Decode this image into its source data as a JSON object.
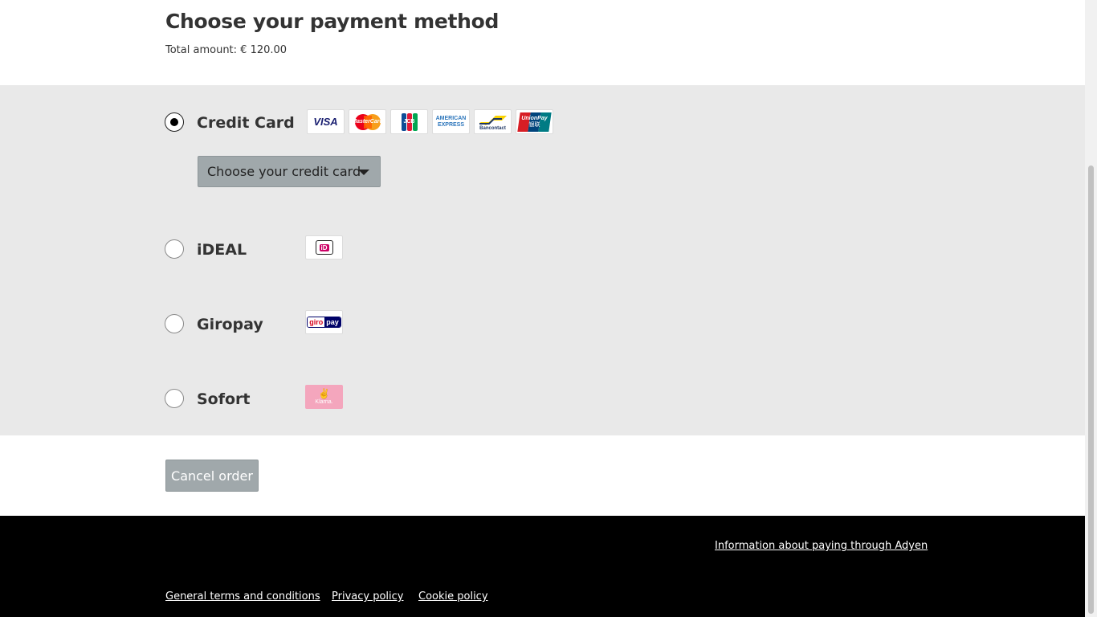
{
  "header": {
    "title": "Choose your payment method",
    "total": "Total amount: € 120.00"
  },
  "methods": [
    {
      "label": "Credit Card",
      "selected": true
    },
    {
      "label": "iDEAL",
      "selected": false
    },
    {
      "label": "Giropay",
      "selected": false
    },
    {
      "label": "Sofort",
      "selected": false
    }
  ],
  "credit_card": {
    "select_label": "Choose your credit card",
    "logos": {
      "visa": "VISA",
      "mastercard": "MasterCard",
      "jcb": "JCB",
      "amex_line1": "AMERICAN",
      "amex_line2": "EXPRESS",
      "bancontact": "Bancontact",
      "unionpay": "UnionPay",
      "unionpay_cn": "银联"
    }
  },
  "logos": {
    "ideal": "iD",
    "giropay_a": "giro",
    "giropay_b": "pay",
    "klarna": "Klarna."
  },
  "actions": {
    "cancel": "Cancel order"
  },
  "footer": {
    "info_link": "Information about paying through Adyen",
    "terms": "General terms and conditions",
    "privacy": "Privacy policy",
    "cookie": "Cookie policy"
  },
  "colors": {
    "methods_bg": "#e9e9e9",
    "button_bg": "#a0a8ab",
    "footer_bg": "#000000"
  }
}
